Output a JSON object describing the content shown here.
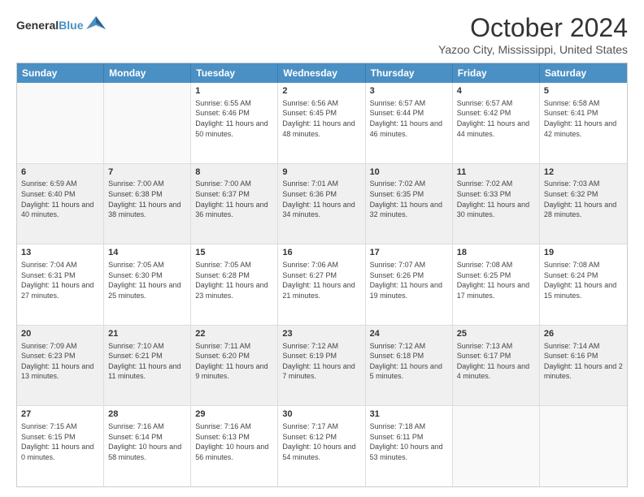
{
  "header": {
    "logo_general": "General",
    "logo_blue": "Blue",
    "month_title": "October 2024",
    "subtitle": "Yazoo City, Mississippi, United States"
  },
  "days_of_week": [
    "Sunday",
    "Monday",
    "Tuesday",
    "Wednesday",
    "Thursday",
    "Friday",
    "Saturday"
  ],
  "weeks": [
    [
      {
        "day": "",
        "sunrise": "",
        "sunset": "",
        "daylight": "",
        "empty": true
      },
      {
        "day": "",
        "sunrise": "",
        "sunset": "",
        "daylight": "",
        "empty": true
      },
      {
        "day": "1",
        "sunrise": "Sunrise: 6:55 AM",
        "sunset": "Sunset: 6:46 PM",
        "daylight": "Daylight: 11 hours and 50 minutes.",
        "empty": false
      },
      {
        "day": "2",
        "sunrise": "Sunrise: 6:56 AM",
        "sunset": "Sunset: 6:45 PM",
        "daylight": "Daylight: 11 hours and 48 minutes.",
        "empty": false
      },
      {
        "day": "3",
        "sunrise": "Sunrise: 6:57 AM",
        "sunset": "Sunset: 6:44 PM",
        "daylight": "Daylight: 11 hours and 46 minutes.",
        "empty": false
      },
      {
        "day": "4",
        "sunrise": "Sunrise: 6:57 AM",
        "sunset": "Sunset: 6:42 PM",
        "daylight": "Daylight: 11 hours and 44 minutes.",
        "empty": false
      },
      {
        "day": "5",
        "sunrise": "Sunrise: 6:58 AM",
        "sunset": "Sunset: 6:41 PM",
        "daylight": "Daylight: 11 hours and 42 minutes.",
        "empty": false
      }
    ],
    [
      {
        "day": "6",
        "sunrise": "Sunrise: 6:59 AM",
        "sunset": "Sunset: 6:40 PM",
        "daylight": "Daylight: 11 hours and 40 minutes.",
        "empty": false
      },
      {
        "day": "7",
        "sunrise": "Sunrise: 7:00 AM",
        "sunset": "Sunset: 6:38 PM",
        "daylight": "Daylight: 11 hours and 38 minutes.",
        "empty": false
      },
      {
        "day": "8",
        "sunrise": "Sunrise: 7:00 AM",
        "sunset": "Sunset: 6:37 PM",
        "daylight": "Daylight: 11 hours and 36 minutes.",
        "empty": false
      },
      {
        "day": "9",
        "sunrise": "Sunrise: 7:01 AM",
        "sunset": "Sunset: 6:36 PM",
        "daylight": "Daylight: 11 hours and 34 minutes.",
        "empty": false
      },
      {
        "day": "10",
        "sunrise": "Sunrise: 7:02 AM",
        "sunset": "Sunset: 6:35 PM",
        "daylight": "Daylight: 11 hours and 32 minutes.",
        "empty": false
      },
      {
        "day": "11",
        "sunrise": "Sunrise: 7:02 AM",
        "sunset": "Sunset: 6:33 PM",
        "daylight": "Daylight: 11 hours and 30 minutes.",
        "empty": false
      },
      {
        "day": "12",
        "sunrise": "Sunrise: 7:03 AM",
        "sunset": "Sunset: 6:32 PM",
        "daylight": "Daylight: 11 hours and 28 minutes.",
        "empty": false
      }
    ],
    [
      {
        "day": "13",
        "sunrise": "Sunrise: 7:04 AM",
        "sunset": "Sunset: 6:31 PM",
        "daylight": "Daylight: 11 hours and 27 minutes.",
        "empty": false
      },
      {
        "day": "14",
        "sunrise": "Sunrise: 7:05 AM",
        "sunset": "Sunset: 6:30 PM",
        "daylight": "Daylight: 11 hours and 25 minutes.",
        "empty": false
      },
      {
        "day": "15",
        "sunrise": "Sunrise: 7:05 AM",
        "sunset": "Sunset: 6:28 PM",
        "daylight": "Daylight: 11 hours and 23 minutes.",
        "empty": false
      },
      {
        "day": "16",
        "sunrise": "Sunrise: 7:06 AM",
        "sunset": "Sunset: 6:27 PM",
        "daylight": "Daylight: 11 hours and 21 minutes.",
        "empty": false
      },
      {
        "day": "17",
        "sunrise": "Sunrise: 7:07 AM",
        "sunset": "Sunset: 6:26 PM",
        "daylight": "Daylight: 11 hours and 19 minutes.",
        "empty": false
      },
      {
        "day": "18",
        "sunrise": "Sunrise: 7:08 AM",
        "sunset": "Sunset: 6:25 PM",
        "daylight": "Daylight: 11 hours and 17 minutes.",
        "empty": false
      },
      {
        "day": "19",
        "sunrise": "Sunrise: 7:08 AM",
        "sunset": "Sunset: 6:24 PM",
        "daylight": "Daylight: 11 hours and 15 minutes.",
        "empty": false
      }
    ],
    [
      {
        "day": "20",
        "sunrise": "Sunrise: 7:09 AM",
        "sunset": "Sunset: 6:23 PM",
        "daylight": "Daylight: 11 hours and 13 minutes.",
        "empty": false
      },
      {
        "day": "21",
        "sunrise": "Sunrise: 7:10 AM",
        "sunset": "Sunset: 6:21 PM",
        "daylight": "Daylight: 11 hours and 11 minutes.",
        "empty": false
      },
      {
        "day": "22",
        "sunrise": "Sunrise: 7:11 AM",
        "sunset": "Sunset: 6:20 PM",
        "daylight": "Daylight: 11 hours and 9 minutes.",
        "empty": false
      },
      {
        "day": "23",
        "sunrise": "Sunrise: 7:12 AM",
        "sunset": "Sunset: 6:19 PM",
        "daylight": "Daylight: 11 hours and 7 minutes.",
        "empty": false
      },
      {
        "day": "24",
        "sunrise": "Sunrise: 7:12 AM",
        "sunset": "Sunset: 6:18 PM",
        "daylight": "Daylight: 11 hours and 5 minutes.",
        "empty": false
      },
      {
        "day": "25",
        "sunrise": "Sunrise: 7:13 AM",
        "sunset": "Sunset: 6:17 PM",
        "daylight": "Daylight: 11 hours and 4 minutes.",
        "empty": false
      },
      {
        "day": "26",
        "sunrise": "Sunrise: 7:14 AM",
        "sunset": "Sunset: 6:16 PM",
        "daylight": "Daylight: 11 hours and 2 minutes.",
        "empty": false
      }
    ],
    [
      {
        "day": "27",
        "sunrise": "Sunrise: 7:15 AM",
        "sunset": "Sunset: 6:15 PM",
        "daylight": "Daylight: 11 hours and 0 minutes.",
        "empty": false
      },
      {
        "day": "28",
        "sunrise": "Sunrise: 7:16 AM",
        "sunset": "Sunset: 6:14 PM",
        "daylight": "Daylight: 10 hours and 58 minutes.",
        "empty": false
      },
      {
        "day": "29",
        "sunrise": "Sunrise: 7:16 AM",
        "sunset": "Sunset: 6:13 PM",
        "daylight": "Daylight: 10 hours and 56 minutes.",
        "empty": false
      },
      {
        "day": "30",
        "sunrise": "Sunrise: 7:17 AM",
        "sunset": "Sunset: 6:12 PM",
        "daylight": "Daylight: 10 hours and 54 minutes.",
        "empty": false
      },
      {
        "day": "31",
        "sunrise": "Sunrise: 7:18 AM",
        "sunset": "Sunset: 6:11 PM",
        "daylight": "Daylight: 10 hours and 53 minutes.",
        "empty": false
      },
      {
        "day": "",
        "sunrise": "",
        "sunset": "",
        "daylight": "",
        "empty": true
      },
      {
        "day": "",
        "sunrise": "",
        "sunset": "",
        "daylight": "",
        "empty": true
      }
    ]
  ]
}
